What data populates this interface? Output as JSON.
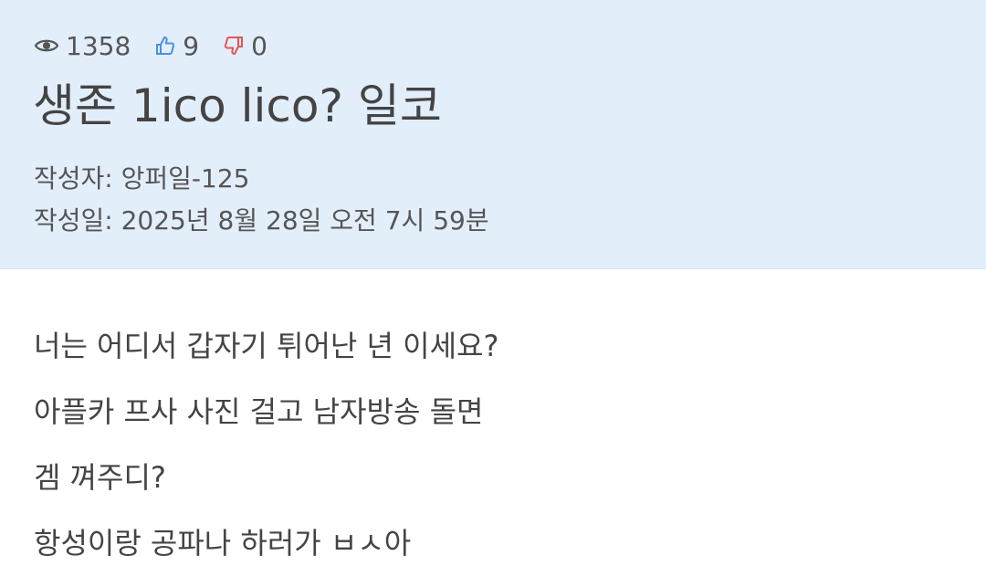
{
  "post": {
    "stats": {
      "views": "1358",
      "likes": "9",
      "dislikes": "0"
    },
    "title": "생존 1ico lico? 일코",
    "author_line": "작성자: 앙퍼일-125",
    "date_line": "작성일: 2025년 8월 28일 오전 7시 59분",
    "body_lines": [
      "너는 어디서 갑자기 튀어난 년 이세요?",
      "아플카 프사 사진 걸고 남자방송 돌면",
      "겜 껴주디?",
      "항성이랑 공파나 하러가 ㅂㅅ아"
    ]
  },
  "icons": {
    "views": "eye-icon",
    "likes": "thumbs-up-icon",
    "dislikes": "thumbs-down-icon"
  },
  "colors": {
    "header_bg": "#e3eefb",
    "like": "#4a90e2",
    "dislike": "#e25555"
  }
}
